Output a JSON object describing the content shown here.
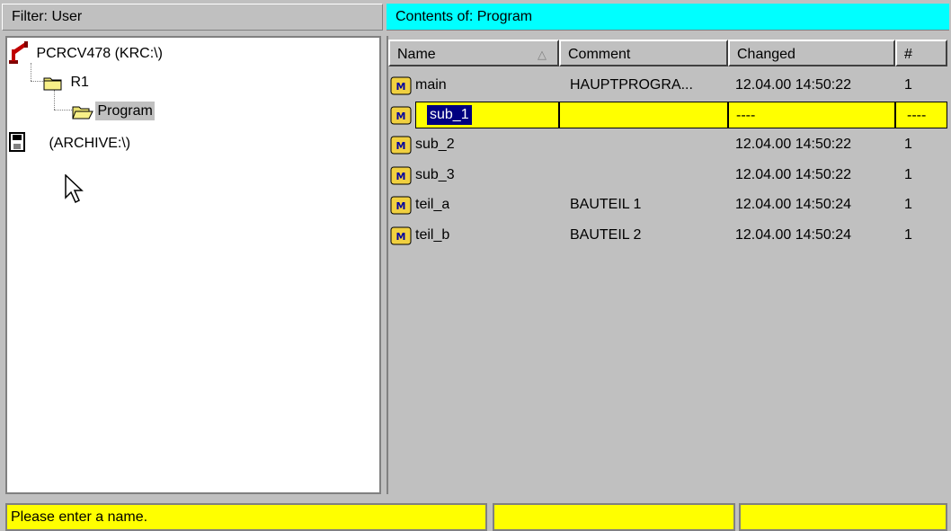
{
  "left_pane": {
    "header": "Filter: User",
    "tree": [
      {
        "label": "PCRCV478 (KRC:\\)"
      },
      {
        "label": "R1"
      },
      {
        "label": "Program"
      },
      {
        "label": "(ARCHIVE:\\)"
      }
    ]
  },
  "right_pane": {
    "header": "Contents of: Program",
    "columns": [
      "Name",
      "Comment",
      "Changed",
      "#"
    ],
    "rows": [
      {
        "name": "main",
        "comment": "HAUPTPROGRA...",
        "changed": "12.04.00 14:50:22",
        "count": "1"
      },
      {
        "name": "sub_1",
        "comment": "",
        "changed": "----",
        "count": "----"
      },
      {
        "name": "sub_2",
        "comment": "",
        "changed": "12.04.00 14:50:22",
        "count": "1"
      },
      {
        "name": "sub_3",
        "comment": "",
        "changed": "12.04.00 14:50:22",
        "count": "1"
      },
      {
        "name": "teil_a",
        "comment": "BAUTEIL 1",
        "changed": "12.04.00 14:50:24",
        "count": "1"
      },
      {
        "name": "teil_b",
        "comment": "BAUTEIL 2",
        "changed": "12.04.00 14:50:24",
        "count": "1"
      }
    ]
  },
  "status_bar": {
    "message": "Please enter a name.",
    "field2": "",
    "field3": ""
  },
  "colors": {
    "header_accent": "#00ffff",
    "highlight": "#ffff00",
    "selection": "#000080",
    "window_bg": "#c0c0c0"
  }
}
